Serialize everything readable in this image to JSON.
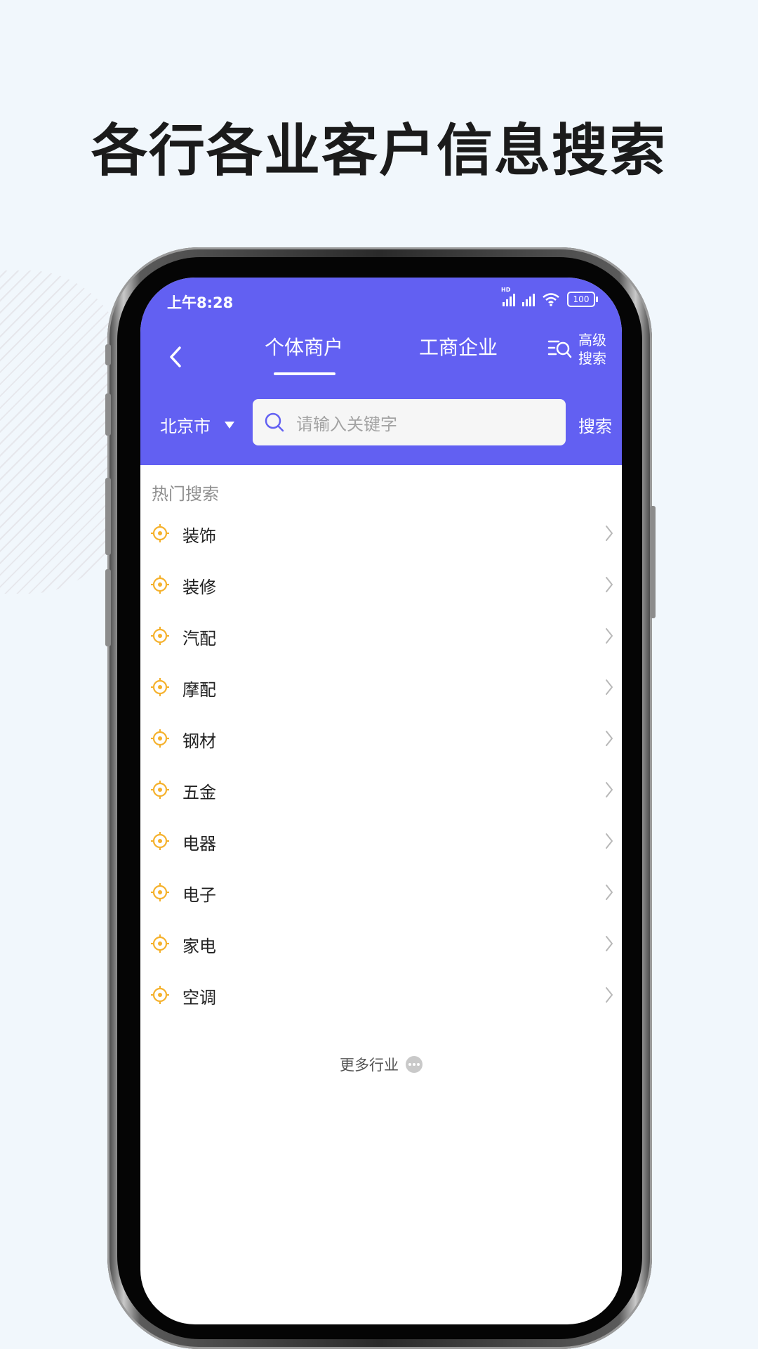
{
  "headline": "各行各业客户信息搜索",
  "status": {
    "time": "上午8:28",
    "signal_label": "HD",
    "battery": "100"
  },
  "tabs": [
    {
      "label": "个体商户",
      "active": true
    },
    {
      "label": "工商企业",
      "active": false
    }
  ],
  "advanced_search": {
    "line1": "高级",
    "line2": "搜索"
  },
  "city": "北京市",
  "search": {
    "placeholder": "请输入关键字",
    "button": "搜索"
  },
  "hot": {
    "title": "热门搜索",
    "items": [
      {
        "label": "装饰"
      },
      {
        "label": "装修"
      },
      {
        "label": "汽配"
      },
      {
        "label": "摩配"
      },
      {
        "label": "钢材"
      },
      {
        "label": "五金"
      },
      {
        "label": "电器"
      },
      {
        "label": "电子"
      },
      {
        "label": "家电"
      },
      {
        "label": "空调"
      }
    ]
  },
  "more_label": "更多行业",
  "colors": {
    "accent": "#6260f2",
    "item_icon": "#f5b12c"
  },
  "icons": [
    "back-arrow-icon",
    "advanced-search-icon",
    "search-icon",
    "target-icon",
    "chevron-right-icon",
    "more-dots-icon"
  ]
}
